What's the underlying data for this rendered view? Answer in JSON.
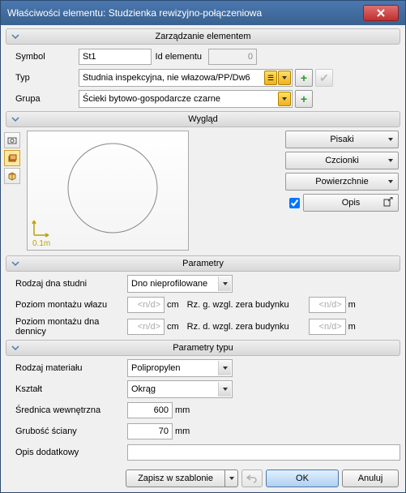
{
  "window": {
    "title": "Właściwości elementu: Studzienka rewizyjno-połączeniowa"
  },
  "sections": {
    "management": "Zarządzanie elementem",
    "appearance": "Wygląd",
    "parameters": "Parametry",
    "type_params": "Parametry typu"
  },
  "management": {
    "symbol_label": "Symbol",
    "symbol_value": "St1",
    "id_label": "Id elementu",
    "id_value": "0",
    "type_label": "Typ",
    "type_value": "Studnia inspekcyjna, nie włazowa/PP/Dw6",
    "group_label": "Grupa",
    "group_value": "Ścieki bytowo-gospodarcze czarne"
  },
  "appearance": {
    "pens": "Pisaki",
    "fonts": "Czcionki",
    "surfaces": "Powierzchnie",
    "desc": "Opis",
    "scale": "0.1m"
  },
  "parameters": {
    "well_bottom_label": "Rodzaj dna studni",
    "well_bottom_value": "Dno nieprofilowane",
    "hatch_level_label": "Poziom montażu włazu",
    "hatch_level_value": "<n/d>",
    "bottom_level_label": "Poziom montażu dna dennicy",
    "bottom_level_value": "<n/d>",
    "rz_g_label": "Rz. g. wzgl. zera budynku",
    "rz_g_value": "<n/d>",
    "rz_d_label": "Rz. d. wzgl. zera budynku",
    "rz_d_value": "<n/d>",
    "unit_cm": "cm",
    "unit_m": "m"
  },
  "type_params": {
    "material_label": "Rodzaj materiału",
    "material_value": "Polipropylen",
    "shape_label": "Kształt",
    "shape_value": "Okrąg",
    "inner_dia_label": "Średnica wewnętrzna",
    "inner_dia_value": "600",
    "wall_thick_label": "Grubość ściany",
    "wall_thick_value": "70",
    "unit_mm": "mm",
    "extra_desc_label": "Opis dodatkowy",
    "extra_desc_value": ""
  },
  "buttons": {
    "save_template": "Zapisz w szablonie",
    "ok": "OK",
    "cancel": "Anuluj"
  }
}
